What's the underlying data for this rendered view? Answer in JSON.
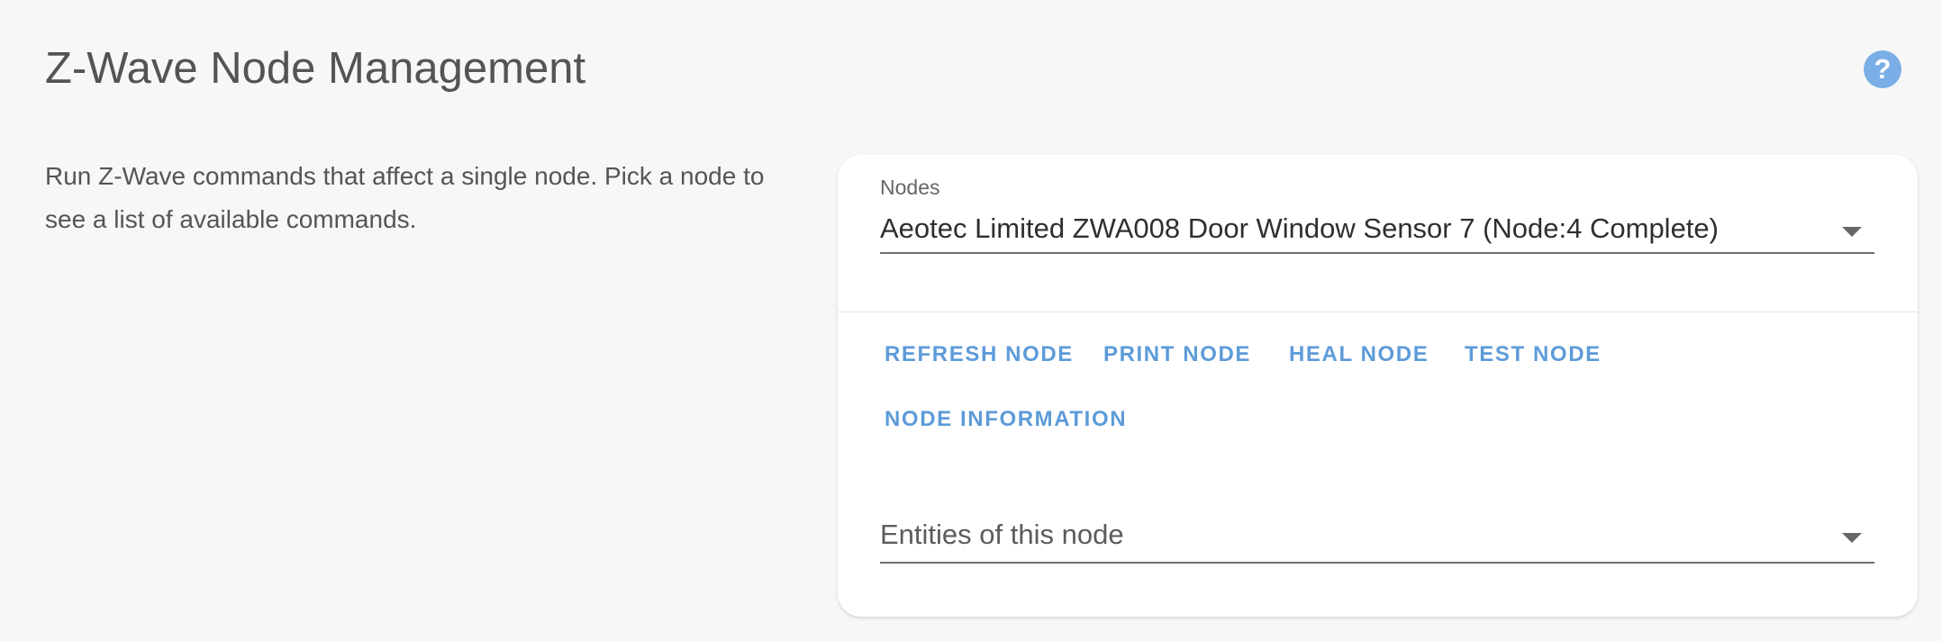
{
  "page": {
    "title": "Z-Wave Node Management",
    "help_icon": "help-circle-icon",
    "help_glyph": "?",
    "description": "Run Z-Wave commands that affect a single node. Pick a node to see a list of available commands."
  },
  "nodes_select": {
    "label": "Nodes",
    "value": "Aeotec Limited ZWA008 Door Window Sensor 7 (Node:4 Complete)"
  },
  "actions": {
    "refresh_node": "REFRESH NODE",
    "print_node": "PRINT NODE",
    "heal_node": "HEAL NODE",
    "test_node": "TEST NODE",
    "node_information": "NODE INFORMATION"
  },
  "entities_select": {
    "placeholder": "Entities of this node"
  },
  "colors": {
    "accent": "#5d9bd9",
    "help_icon": "#7aaee6",
    "background": "#f7f7f7",
    "card": "#ffffff"
  }
}
